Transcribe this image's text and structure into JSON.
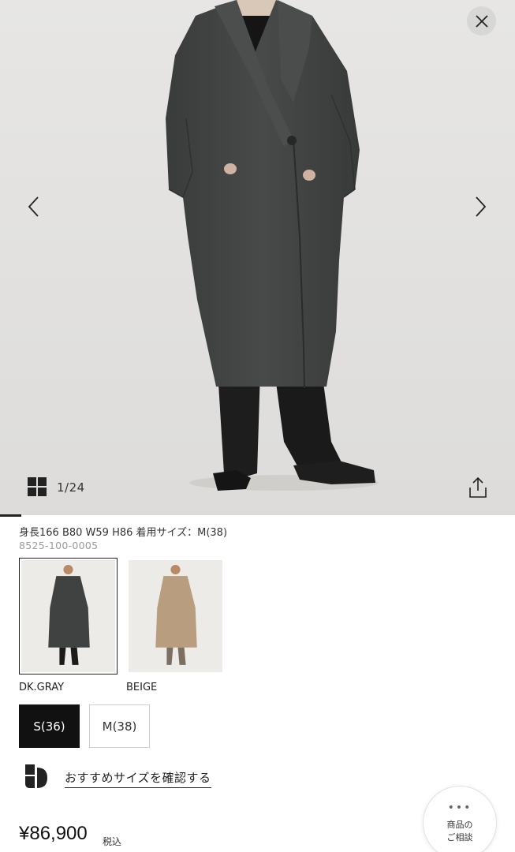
{
  "gallery": {
    "counter": "1/24",
    "image_subject": "dark gray long coat",
    "icons": {
      "close": "close-icon",
      "prev": "chevron-left-icon",
      "next": "chevron-right-icon",
      "grid": "grid-icon",
      "share": "share-icon"
    }
  },
  "product": {
    "model_info": "身長166 B80 W59 H86 着用サイズ：M(38)",
    "code": "8525-100-0005"
  },
  "colors": [
    {
      "label": "DK.GRAY",
      "swatch": "#3f4240",
      "selected": true
    },
    {
      "label": "BEIGE",
      "swatch": "#b89d7e",
      "selected": false
    }
  ],
  "sizes": [
    {
      "label": "S(36)",
      "selected": true
    },
    {
      "label": "M(38)",
      "selected": false
    }
  ],
  "recommend": {
    "label": "おすすめサイズを確認する",
    "icon": "size-advisor-logo-icon"
  },
  "price": {
    "value": "¥86,900",
    "tax": "税込"
  },
  "consult": {
    "dots": "•••",
    "line1": "商品の",
    "line2": "ご相談"
  },
  "theme": {
    "accent": "#111111",
    "gallery_bg": "#e4e3e1"
  }
}
